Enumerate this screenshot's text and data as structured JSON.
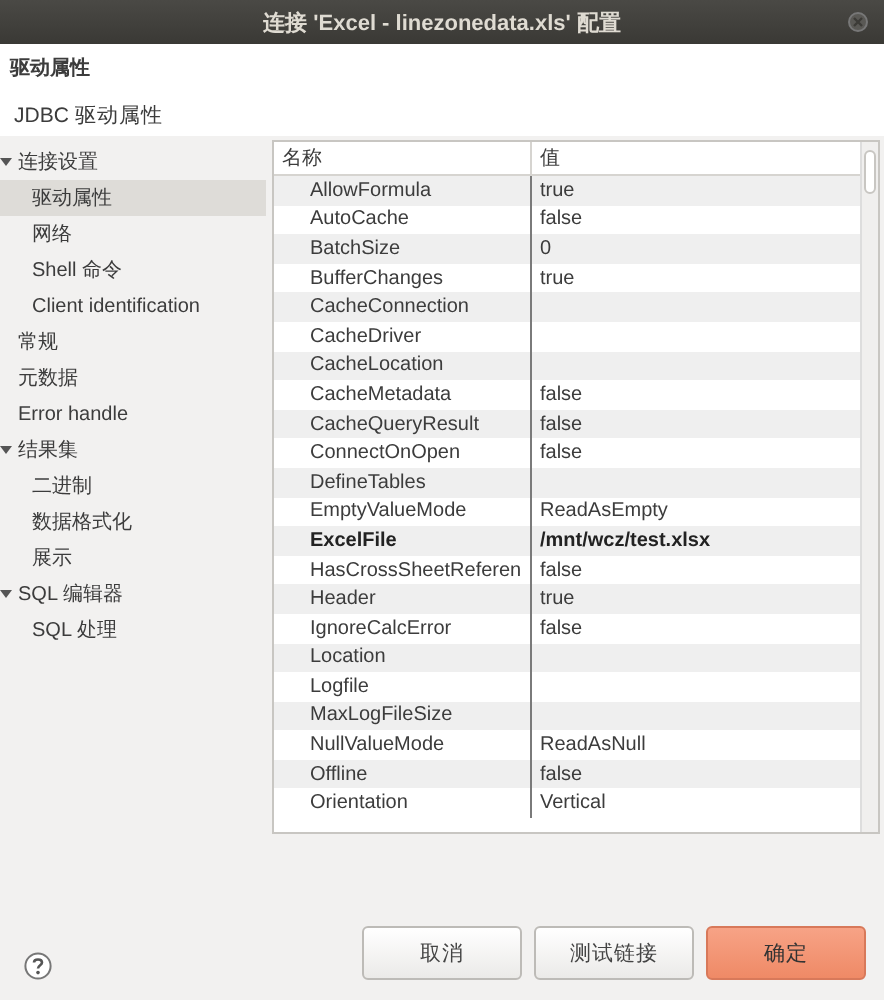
{
  "window": {
    "title": "连接 'Excel - linezonedata.xls' 配置"
  },
  "header": {
    "title": "驱动属性",
    "subtitle": "JDBC 驱动属性"
  },
  "tree": [
    {
      "label": "连接设置",
      "expanded": true,
      "selected": false,
      "children": [
        {
          "label": "驱动属性",
          "selected": true
        },
        {
          "label": "网络",
          "selected": false
        },
        {
          "label": "Shell 命令",
          "selected": false
        },
        {
          "label": "Client identification",
          "selected": false
        }
      ]
    },
    {
      "label": "常规",
      "selected": false
    },
    {
      "label": "元数据",
      "selected": false
    },
    {
      "label": "Error handle",
      "selected": false
    },
    {
      "label": "结果集",
      "expanded": true,
      "selected": false,
      "children": [
        {
          "label": "二进制",
          "selected": false
        },
        {
          "label": "数据格式化",
          "selected": false
        },
        {
          "label": "展示",
          "selected": false
        }
      ]
    },
    {
      "label": "SQL 编辑器",
      "expanded": true,
      "selected": false,
      "children": [
        {
          "label": "SQL 处理",
          "selected": false
        }
      ]
    }
  ],
  "table": {
    "columns": [
      "名称",
      "值"
    ],
    "rows": [
      {
        "name": "AllowFormula",
        "value": "true",
        "modified": false
      },
      {
        "name": "AutoCache",
        "value": "false",
        "modified": false
      },
      {
        "name": "BatchSize",
        "value": "0",
        "modified": false
      },
      {
        "name": "BufferChanges",
        "value": "true",
        "modified": false
      },
      {
        "name": "CacheConnection",
        "modified": false
      },
      {
        "name": "CacheDriver",
        "modified": false
      },
      {
        "name": "CacheLocation",
        "modified": false
      },
      {
        "name": "CacheMetadata",
        "value": "false",
        "modified": false
      },
      {
        "name": "CacheQueryResult",
        "value": "false",
        "modified": false
      },
      {
        "name": "ConnectOnOpen",
        "value": "false",
        "modified": false
      },
      {
        "name": "DefineTables",
        "modified": false
      },
      {
        "name": "EmptyValueMode",
        "value": "ReadAsEmpty",
        "modified": false
      },
      {
        "name": "ExcelFile",
        "value": "/mnt/wcz/test.xlsx",
        "modified": true
      },
      {
        "name": "HasCrossSheetReferen",
        "value": "false",
        "modified": false
      },
      {
        "name": "Header",
        "value": "true",
        "modified": false
      },
      {
        "name": "IgnoreCalcError",
        "value": "false",
        "modified": false
      },
      {
        "name": "Location",
        "modified": false
      },
      {
        "name": "Logfile",
        "modified": false
      },
      {
        "name": "MaxLogFileSize",
        "modified": false
      },
      {
        "name": "NullValueMode",
        "value": "ReadAsNull",
        "modified": false
      },
      {
        "name": "Offline",
        "value": "false",
        "modified": false
      },
      {
        "name": "Orientation",
        "value": "Vertical",
        "modified": false
      }
    ]
  },
  "buttons": [
    {
      "label": "取消",
      "default": false
    },
    {
      "label": "测试链接",
      "default": false
    },
    {
      "label": "确定",
      "default": true
    }
  ]
}
